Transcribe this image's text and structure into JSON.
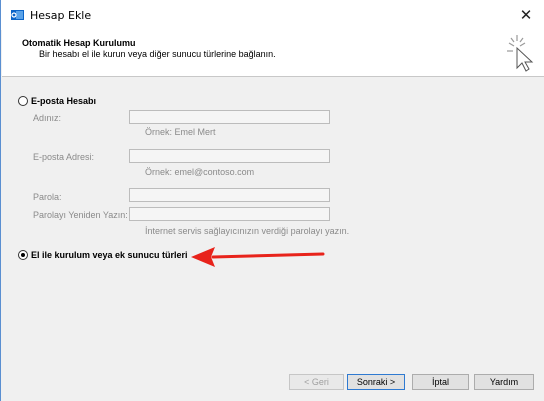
{
  "window": {
    "title": "Hesap Ekle",
    "close_glyph": "✕"
  },
  "header": {
    "title": "Otomatik Hesap Kurulumu",
    "subtitle": "Bir hesabı el ile kurun veya diğer sunucu türlerine bağlanın."
  },
  "email_option": {
    "label": "E-posta Hesabı",
    "selected": false,
    "fields": {
      "name": {
        "label": "Adınız:",
        "value": "",
        "hint": "Örnek: Emel Mert"
      },
      "email": {
        "label": "E-posta Adresi:",
        "value": "",
        "hint": "Örnek: emel@contoso.com"
      },
      "password": {
        "label": "Parola:",
        "value": ""
      },
      "password_confirm": {
        "label": "Parolayı Yeniden Yazın:",
        "value": "",
        "hint": "İnternet servis sağlayıcınızın verdiği parolayı yazın."
      }
    }
  },
  "manual_option": {
    "label": "El ile kurulum veya ek sunucu türleri",
    "selected": true
  },
  "annotation": {
    "arrow_color": "#e8231b"
  },
  "buttons": {
    "back": "< Geri",
    "next": "Sonraki >",
    "cancel": "İptal",
    "help": "Yardım"
  }
}
